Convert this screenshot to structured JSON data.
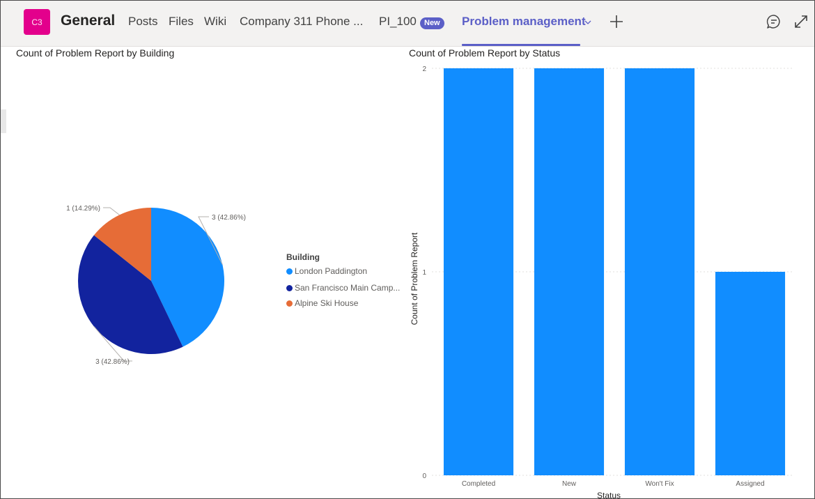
{
  "header": {
    "avatar_text": "C3",
    "channel_title": "General",
    "tabs": [
      {
        "label": "Posts"
      },
      {
        "label": "Files"
      },
      {
        "label": "Wiki"
      },
      {
        "label": "Company 311 Phone ..."
      },
      {
        "label": "PI_100"
      },
      {
        "label": "Problem management"
      }
    ],
    "new_badge": "New",
    "accent_color": "#5b5fc7"
  },
  "pie_visual": {
    "title": "Count of Problem Report by Building",
    "legend_title": "Building",
    "legend": [
      {
        "label": "London Paddington",
        "color": "#118dff"
      },
      {
        "label": "San Francisco Main Camp...",
        "color": "#12239e"
      },
      {
        "label": "Alpine Ski House",
        "color": "#e66c37"
      }
    ]
  },
  "bar_visual": {
    "title": "Count of Problem Report by Status"
  },
  "chart_data": [
    {
      "type": "pie",
      "title": "Count of Problem Report by Building",
      "legend_title": "Building",
      "slices": [
        {
          "label": "London Paddington",
          "value": 3,
          "data_label": "3 (42.86%)",
          "color": "#118dff"
        },
        {
          "label": "San Francisco Main Camp...",
          "value": 3,
          "data_label": "3 (42.86%)",
          "color": "#12239e"
        },
        {
          "label": "Alpine Ski House",
          "value": 1,
          "data_label": "1 (14.29%)",
          "color": "#e66c37"
        }
      ],
      "legend_position": "right"
    },
    {
      "type": "bar",
      "title": "Count of Problem Report by Status",
      "categories": [
        "Completed",
        "New",
        "Won't Fix",
        "Assigned"
      ],
      "values": [
        2,
        2,
        2,
        1
      ],
      "xlabel": "Status",
      "ylabel": "Count of Problem Report",
      "yticks": [
        "0",
        "1",
        "2"
      ],
      "ylim": [
        0,
        2
      ],
      "grid": true,
      "color": "#118dff"
    }
  ]
}
